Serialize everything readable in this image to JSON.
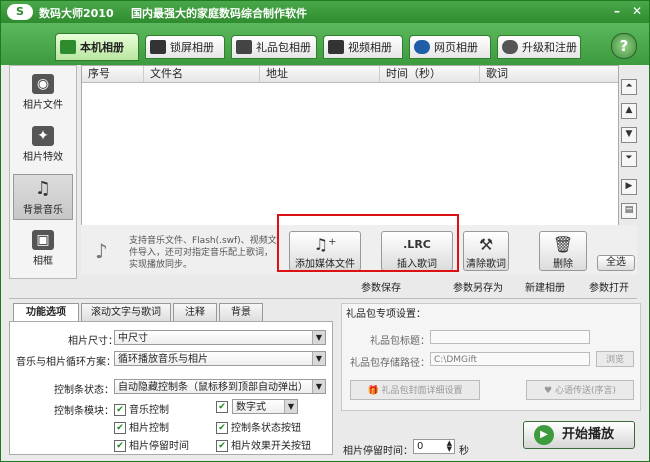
{
  "window": {
    "app_name": "数码大师2010",
    "slogan": "国内最强大的家庭数码综合制作软件",
    "minimize": "–",
    "close": "✕"
  },
  "top_tabs": [
    {
      "label": "本机相册",
      "active": true
    },
    {
      "label": "锁屏相册"
    },
    {
      "label": "礼品包相册"
    },
    {
      "label": "视频相册"
    },
    {
      "label": "网页相册"
    },
    {
      "label": "升级和注册"
    }
  ],
  "help_label": "?",
  "left_nav": [
    {
      "label": "相片文件",
      "icon": "camera-icon"
    },
    {
      "label": "相片特效",
      "icon": "effects-icon"
    },
    {
      "label": "背景音乐",
      "icon": "music-icon",
      "active": true
    },
    {
      "label": "相框",
      "icon": "frame-icon"
    }
  ],
  "table": {
    "columns": [
      "序号",
      "文件名",
      "地址",
      "时间（秒）",
      "歌词"
    ]
  },
  "side_buttons": [
    "⏶",
    "▲",
    "▼",
    "⏷",
    "▶",
    "▤"
  ],
  "info": {
    "text": "支持音乐文件、Flash(.swf)、视频文件导入，还可对指定音乐配上歌词，实现播放同步。"
  },
  "actions": {
    "add_media": "添加媒体文件",
    "insert_lyrics": "插入歌词",
    "insert_lyrics_icon_text": ".LRC",
    "clear_lyrics": "清除歌词",
    "delete": "删除",
    "select_all": "全选"
  },
  "toolbar": {
    "save_params": "参数保存",
    "save_params_as": "参数另存为",
    "new_album": "新建相册",
    "open_params": "参数打开"
  },
  "bottom_tabs": [
    "功能选项",
    "滚动文字与歌词",
    "注释",
    "背景"
  ],
  "options": {
    "photo_size_label": "相片尺寸：",
    "photo_size_value": "中尺寸",
    "loop_label": "音乐与相片循环方案：",
    "loop_value": "循环播放音乐与相片",
    "control_bar_label": "控制条状态：",
    "control_bar_value": "自动隐藏控制条（鼠标移到顶部自动弹出）",
    "control_module_label": "控制条模块：",
    "checks": [
      {
        "label": "音乐控制",
        "checked": true
      },
      {
        "label": "数字式",
        "checked": true
      },
      {
        "label": "相片控制",
        "checked": true
      },
      {
        "label": "控制条状态按钮",
        "checked": true
      },
      {
        "label": "相片停留时间",
        "checked": true
      },
      {
        "label": "相片效果开关按钮",
        "checked": true
      }
    ]
  },
  "gift": {
    "section_title": "礼品包专项设置：",
    "title_label": "礼品包标题：",
    "title_value": "",
    "save_path_label": "礼品包存储路径：",
    "save_path_value": "C:\\DMGift",
    "browse_label": "浏览",
    "cover_button": "礼品包封面详细设置",
    "heart_button": "心语传送(序言)"
  },
  "stay": {
    "label": "相片停留时间：",
    "value": "0",
    "unit": "秒"
  },
  "start_button": "开始播放"
}
